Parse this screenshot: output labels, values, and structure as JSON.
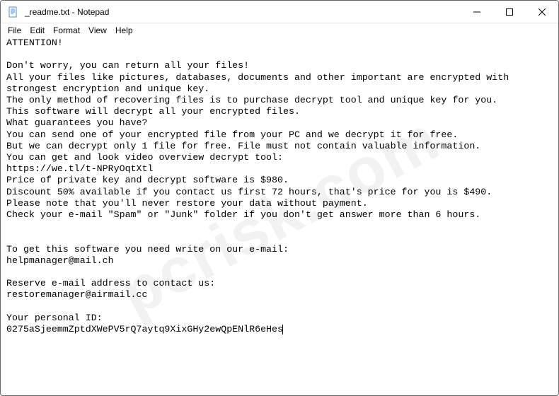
{
  "titlebar": {
    "title": "_readme.txt - Notepad"
  },
  "menu": {
    "file": "File",
    "edit": "Edit",
    "format": "Format",
    "view": "View",
    "help": "Help"
  },
  "body": "ATTENTION!\n\nDon't worry, you can return all your files!\nAll your files like pictures, databases, documents and other important are encrypted with strongest encryption and unique key.\nThe only method of recovering files is to purchase decrypt tool and unique key for you.\nThis software will decrypt all your encrypted files.\nWhat guarantees you have?\nYou can send one of your encrypted file from your PC and we decrypt it for free.\nBut we can decrypt only 1 file for free. File must not contain valuable information.\nYou can get and look video overview decrypt tool:\nhttps://we.tl/t-NPRyOqtXtl\nPrice of private key and decrypt software is $980.\nDiscount 50% available if you contact us first 72 hours, that's price for you is $490.\nPlease note that you'll never restore your data without payment.\nCheck your e-mail \"Spam\" or \"Junk\" folder if you don't get answer more than 6 hours.\n\n\nTo get this software you need write on our e-mail:\nhelpmanager@mail.ch\n\nReserve e-mail address to contact us:\nrestoremanager@airmail.cc\n\nYour personal ID:\n0275aSjeemmZptdXWePV5rQ7aytq9XixGHy2ewQpENlR6eHes",
  "watermark": "pcrisk.com"
}
